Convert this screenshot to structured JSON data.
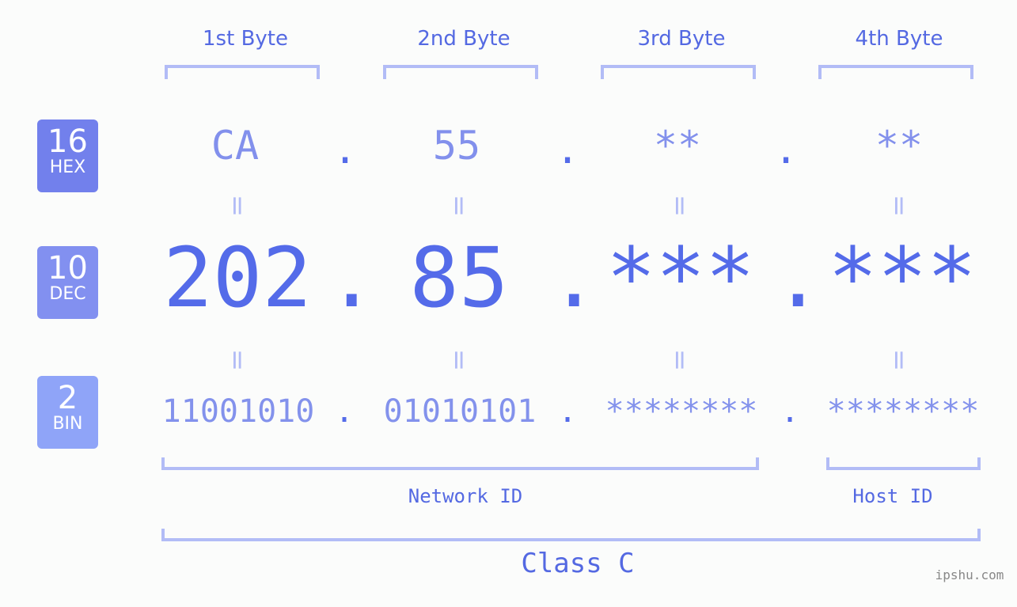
{
  "bytes": [
    {
      "label": "1st Byte",
      "hex": "CA",
      "dec": "202",
      "bin": "11001010"
    },
    {
      "label": "2nd Byte",
      "hex": "55",
      "dec": "85",
      "bin": "01010101"
    },
    {
      "label": "3rd Byte",
      "hex": "**",
      "dec": "***",
      "bin": "********"
    },
    {
      "label": "4th Byte",
      "hex": "**",
      "dec": "***",
      "bin": "********"
    }
  ],
  "badges": {
    "hex": {
      "num": "16",
      "label": "HEX",
      "color": "#7280ec"
    },
    "dec": {
      "num": "10",
      "label": "DEC",
      "color": "#8290f0"
    },
    "bin": {
      "num": "2",
      "label": "BIN",
      "color": "#8fa4f8"
    }
  },
  "separator": ".",
  "equals": "=",
  "network_id_label": "Network ID",
  "host_id_label": "Host ID",
  "class_label": "Class C",
  "footer": "ipshu.com"
}
